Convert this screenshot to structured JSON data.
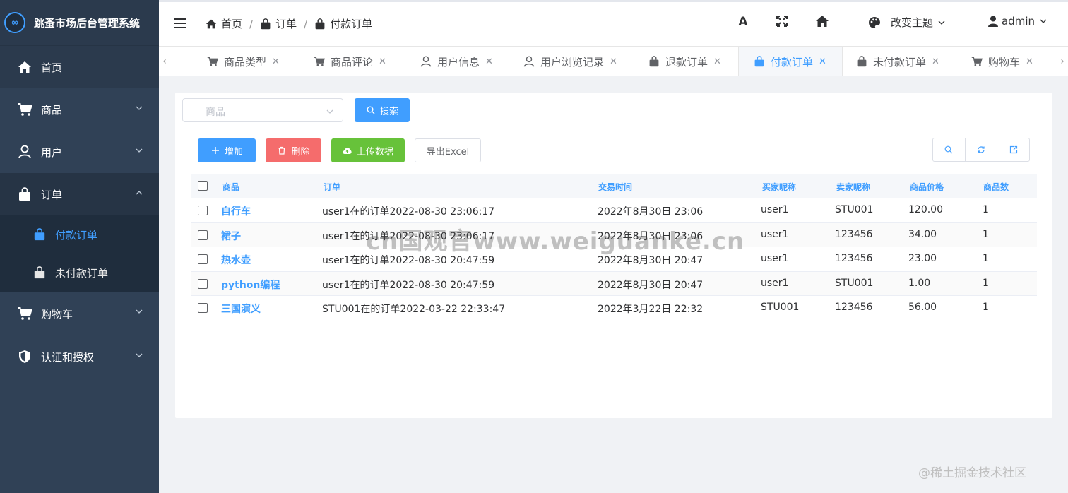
{
  "sidebar": {
    "title": "跳蚤市场后台管理系统",
    "logo_text": "∞",
    "items": [
      {
        "label": "首页",
        "icon": "home-icon"
      },
      {
        "label": "商品",
        "icon": "cart-icon"
      },
      {
        "label": "用户",
        "icon": "user-icon"
      },
      {
        "label": "订单",
        "icon": "bag-icon"
      },
      {
        "label": "购物车",
        "icon": "cart-icon"
      },
      {
        "label": "认证和授权",
        "icon": "shield-icon"
      }
    ],
    "submenu": [
      {
        "label": "付款订单",
        "icon": "bag-icon",
        "active": true
      },
      {
        "label": "未付款订单",
        "icon": "bag-icon",
        "active": false
      }
    ],
    "colors": {
      "bg": "#304156",
      "active": "#409eff"
    }
  },
  "navbar": {
    "breadcrumb": [
      "首页",
      "订单",
      "付款订单"
    ],
    "theme_label": "改变主题",
    "user_label": "admin",
    "font_btn": "A"
  },
  "tabs": [
    {
      "label": "商品类型",
      "icon": "cart-icon"
    },
    {
      "label": "商品评论",
      "icon": "cart-icon"
    },
    {
      "label": "用户信息",
      "icon": "user-icon"
    },
    {
      "label": "用户浏览记录",
      "icon": "user-icon"
    },
    {
      "label": "退款订单",
      "icon": "bag-icon"
    },
    {
      "label": "付款订单",
      "icon": "bag-icon",
      "active": true
    },
    {
      "label": "未付款订单",
      "icon": "bag-icon"
    },
    {
      "label": "购物车",
      "icon": "cart-icon"
    }
  ],
  "toolbar": {
    "select_placeholder": "商品",
    "search": "搜索",
    "add": "增加",
    "delete": "删除",
    "upload": "上传数据",
    "export": "导出Excel"
  },
  "table": {
    "headers": [
      "商品",
      "订单",
      "交易时间",
      "买家昵称",
      "卖家昵称",
      "商品价格",
      "商品数"
    ],
    "rows": [
      [
        "自行车",
        "user1在的订单2022-08-30 23:06:17",
        "2022年8月30日 23:06",
        "user1",
        "STU001",
        "120.00",
        "1"
      ],
      [
        "裙子",
        "user1在的订单2022-08-30 23:06:17",
        "2022年8月30日 23:06",
        "user1",
        "123456",
        "34.00",
        "1"
      ],
      [
        "热水壶",
        "user1在的订单2022-08-30 20:47:59",
        "2022年8月30日 20:47",
        "user1",
        "123456",
        "23.00",
        "1"
      ],
      [
        "python编程",
        "user1在的订单2022-08-30 20:47:59",
        "2022年8月30日 20:47",
        "user1",
        "STU001",
        "1.00",
        "1"
      ],
      [
        "三国演义",
        "STU001在的订单2022-03-22 22:33:47",
        "2022年3月22日 22:32",
        "STU001",
        "123456",
        "56.00",
        "1"
      ]
    ]
  },
  "watermark": "@稀土掘金技术社区",
  "overlay_watermark": "cn国观官www.weiguanke.cn"
}
